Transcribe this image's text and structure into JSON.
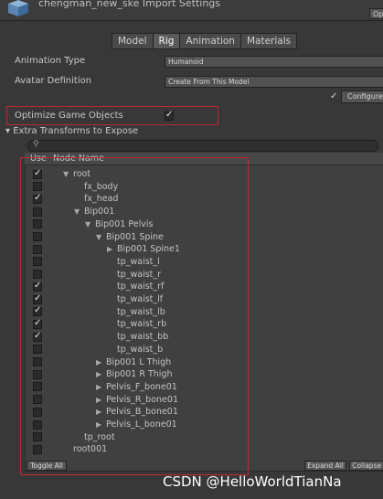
{
  "header": {
    "title": "chengman_new_ske Import Settings",
    "open_label": "Op"
  },
  "tabs": [
    "Model",
    "Rig",
    "Animation",
    "Materials"
  ],
  "active_tab": "Rig",
  "fields": {
    "animation_type_label": "Animation Type",
    "animation_type_value": "Humanoid",
    "avatar_definition_label": "Avatar Definition",
    "avatar_definition_value": "Create From This Model",
    "configure_label": "Configure",
    "optimize_label": "Optimize Game Objects",
    "optimize_checked": true,
    "extra_transforms_label": "Extra Transforms to Expose"
  },
  "table": {
    "col_use": "Use",
    "col_node": "Node Name",
    "rows": [
      {
        "name": "root",
        "checked": true,
        "indent": 0,
        "arrow": "down"
      },
      {
        "name": "fx_body",
        "checked": false,
        "indent": 1,
        "arrow": ""
      },
      {
        "name": "fx_head",
        "checked": true,
        "indent": 1,
        "arrow": ""
      },
      {
        "name": "Bip001",
        "checked": false,
        "indent": 1,
        "arrow": "down"
      },
      {
        "name": "Bip001 Pelvis",
        "checked": false,
        "indent": 2,
        "arrow": "down"
      },
      {
        "name": "Bip001 Spine",
        "checked": false,
        "indent": 3,
        "arrow": "down"
      },
      {
        "name": "Bip001 Spine1",
        "checked": false,
        "indent": 4,
        "arrow": "right"
      },
      {
        "name": "tp_waist_l",
        "checked": false,
        "indent": 4,
        "arrow": ""
      },
      {
        "name": "tp_waist_r",
        "checked": false,
        "indent": 4,
        "arrow": ""
      },
      {
        "name": "tp_waist_rf",
        "checked": true,
        "indent": 4,
        "arrow": ""
      },
      {
        "name": "tp_waist_lf",
        "checked": true,
        "indent": 4,
        "arrow": ""
      },
      {
        "name": "tp_waist_lb",
        "checked": true,
        "indent": 4,
        "arrow": ""
      },
      {
        "name": "tp_waist_rb",
        "checked": true,
        "indent": 4,
        "arrow": ""
      },
      {
        "name": "tp_waist_bb",
        "checked": true,
        "indent": 4,
        "arrow": ""
      },
      {
        "name": "tp_waist_b",
        "checked": false,
        "indent": 4,
        "arrow": ""
      },
      {
        "name": "Bip001 L Thigh",
        "checked": false,
        "indent": 3,
        "arrow": "right"
      },
      {
        "name": "Bip001 R Thigh",
        "checked": false,
        "indent": 3,
        "arrow": "right"
      },
      {
        "name": "Pelvis_F_bone01",
        "checked": false,
        "indent": 3,
        "arrow": "right"
      },
      {
        "name": "Pelvis_R_bone01",
        "checked": false,
        "indent": 3,
        "arrow": "right"
      },
      {
        "name": "Pelvis_B_bone01",
        "checked": false,
        "indent": 3,
        "arrow": "right"
      },
      {
        "name": "Pelvis_L_bone01",
        "checked": false,
        "indent": 3,
        "arrow": "right"
      },
      {
        "name": "tp_root",
        "checked": false,
        "indent": 1,
        "arrow": ""
      },
      {
        "name": "root001",
        "checked": false,
        "indent": 0,
        "arrow": ""
      }
    ]
  },
  "buttons": {
    "toggle_all": "Toggle All",
    "expand_all": "Expand All",
    "collapse_all": "Collapse All"
  },
  "watermark": "CSDN @HelloWorldTianNa",
  "colors": {
    "highlight": "#c0282d",
    "background": "#383838"
  }
}
